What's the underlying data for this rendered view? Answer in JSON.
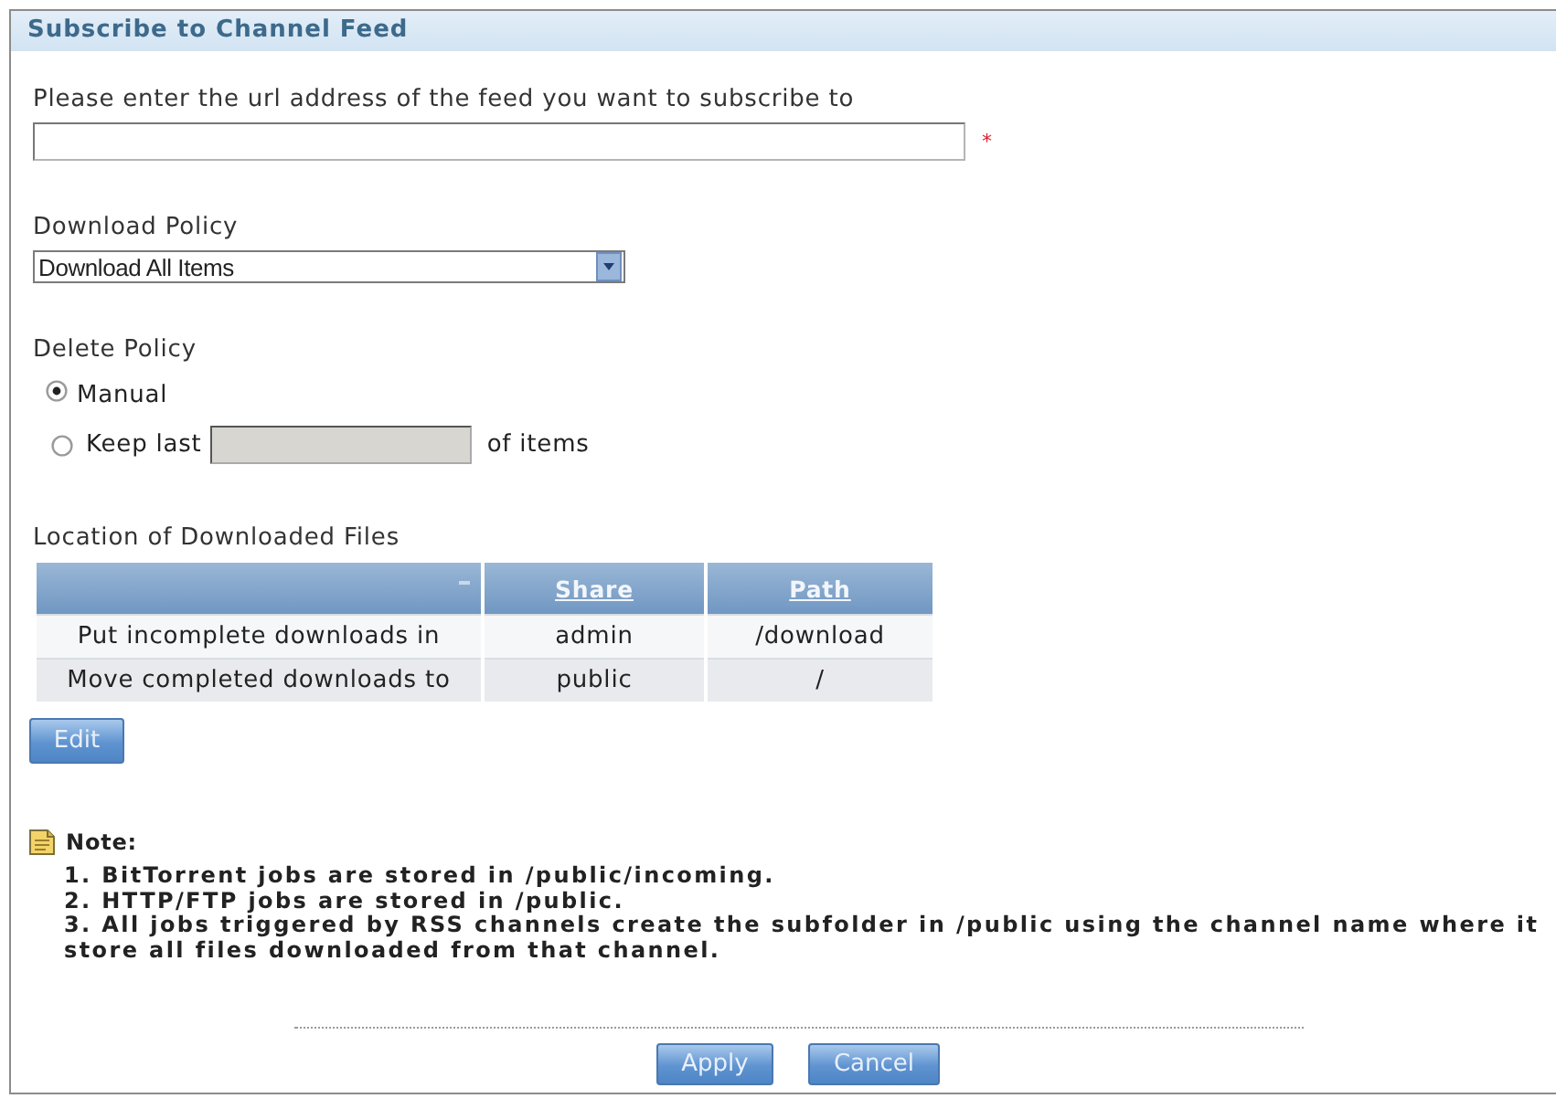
{
  "panel": {
    "title": "Subscribe to Channel Feed"
  },
  "url_field": {
    "label": "Please enter the url address of the feed you want to subscribe to",
    "required_mark": "*"
  },
  "download_policy": {
    "label": "Download Policy",
    "value": "Download All Items"
  },
  "delete_policy": {
    "label": "Delete Policy",
    "options": [
      {
        "label": "Manual",
        "selected": true
      },
      {
        "label": "Keep last",
        "selected": false,
        "field": {
          "disabled": true
        },
        "suffix": "of items"
      }
    ]
  },
  "location": {
    "label": "Location of Downloaded Files",
    "table": {
      "columns": [
        {
          "kind": "menu"
        },
        {
          "kind": "sortable",
          "label": "Share"
        },
        {
          "kind": "sortable",
          "label": "Path"
        }
      ],
      "rows": [
        [
          "Put incomplete downloads in",
          "admin",
          "/download"
        ],
        [
          "Move completed downloads to",
          "public",
          "/"
        ]
      ]
    },
    "edit_button": "Edit"
  },
  "note": {
    "title": "Note:",
    "items": [
      "1. BitTorrent jobs are stored in /public/incoming.",
      "2. HTTP/FTP jobs are stored in /public.",
      "3. All jobs triggered by RSS channels create the subfolder in /public using the channel name where it store all files downloaded from that channel."
    ]
  },
  "buttons": [
    "Apply",
    "Cancel"
  ]
}
